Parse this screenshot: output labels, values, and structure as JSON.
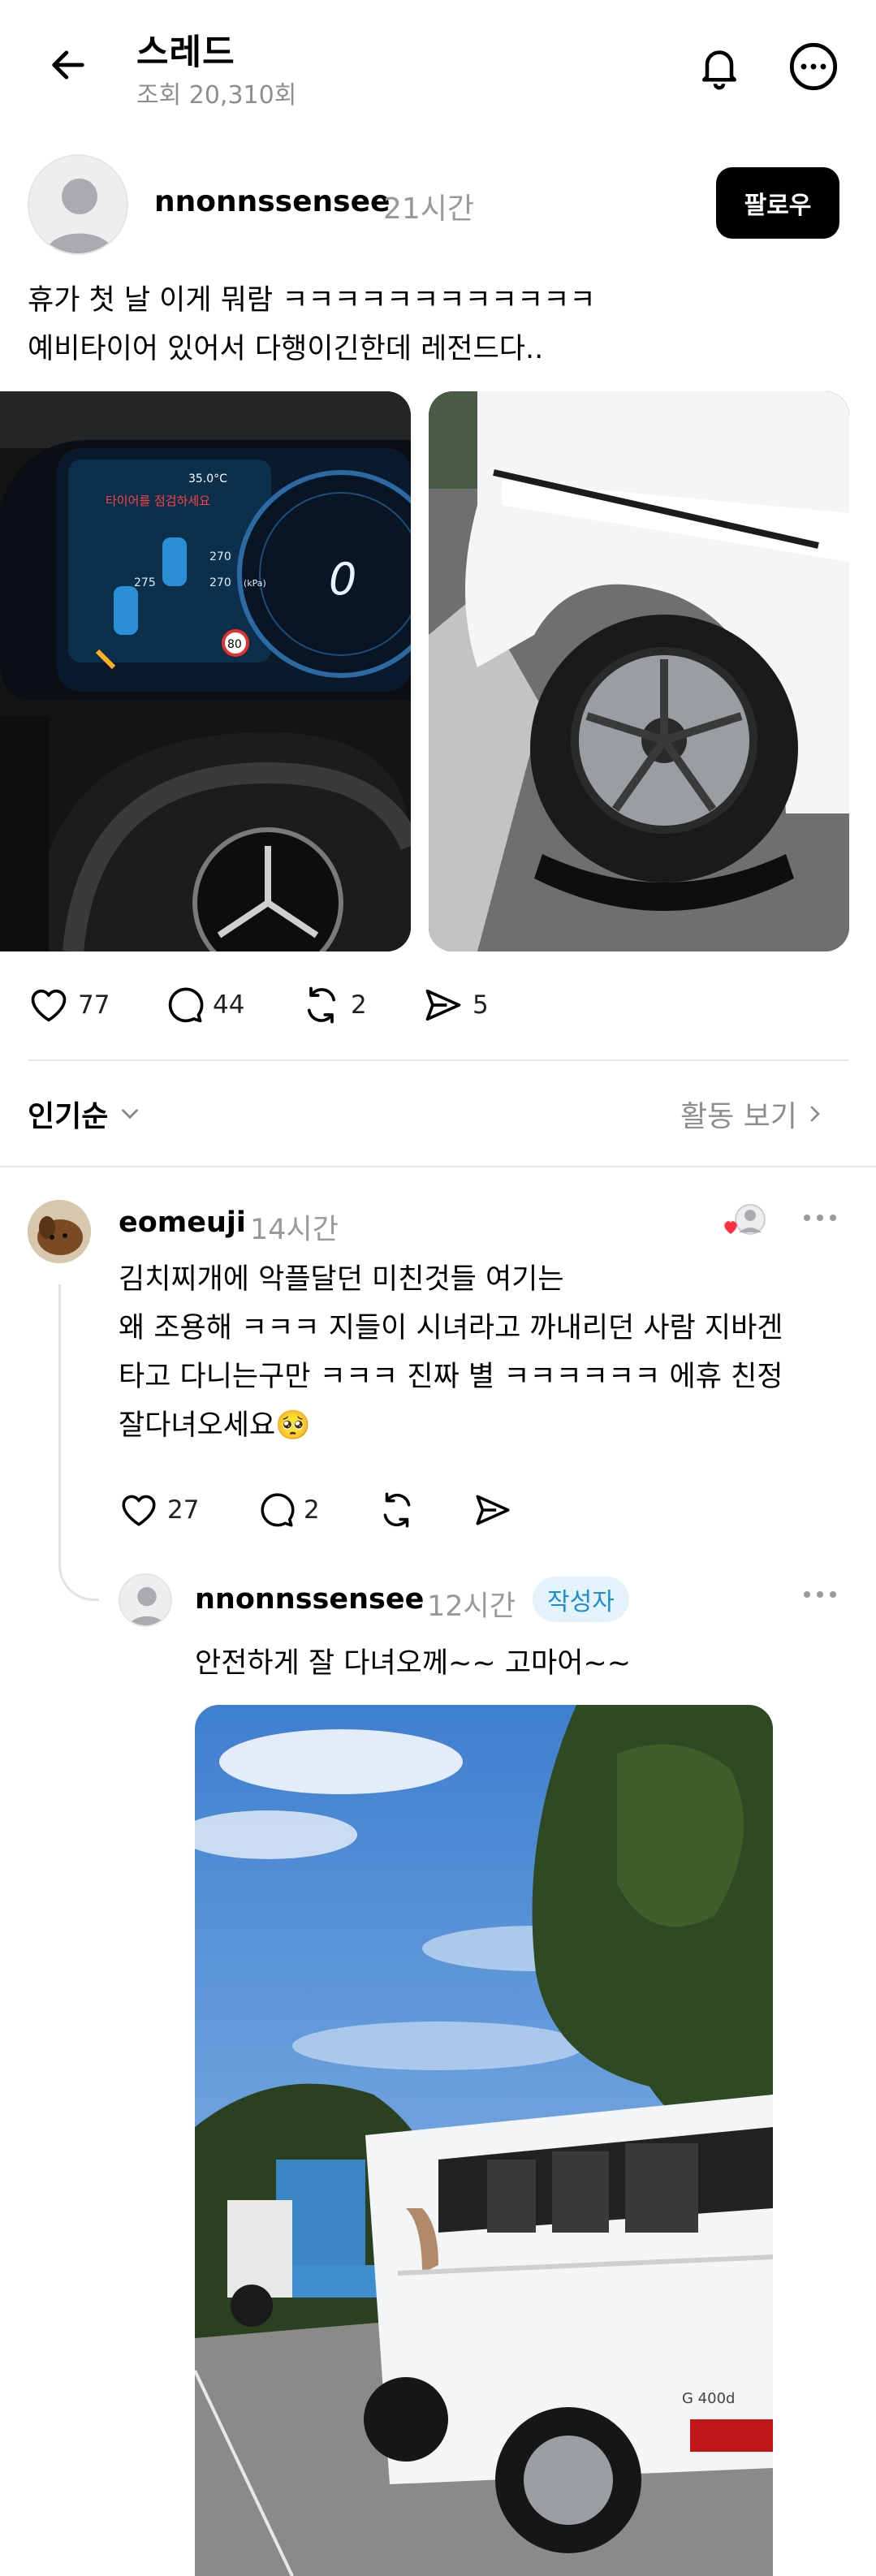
{
  "header": {
    "title": "스레드",
    "views": "조회 20,310회"
  },
  "post": {
    "username": "nnonnssensee",
    "time": "21시간",
    "follow_label": "팔로우",
    "text_lines": [
      "휴가 첫 날 이게 뭐람 ㅋㅋㅋㅋㅋㅋㅋㅋㅋㅋㅋㅋ",
      "예비타이어 있어서 다행이긴한데 레전드다.."
    ],
    "image1_alt": "tire pressure warning on dashboard",
    "image1_texts": {
      "warning": "타이어를 점검하세요",
      "temp": "35.0°C",
      "fl": "270",
      "rl": "275",
      "rr": "270",
      "unit": "(kPa)",
      "speed": "0",
      "limit": "80"
    },
    "image2_alt": "flat tire on white SUV",
    "likes": "77",
    "comments": "44",
    "reposts": "2",
    "shares": "5"
  },
  "sort": {
    "label": "인기순",
    "activity_label": "활동 보기"
  },
  "comment": {
    "username": "eomeuji",
    "time": "14시간",
    "text_lines": [
      "김치찌개에 악플달던 미친것들 여기는",
      "왜 조용해 ㅋㅋㅋ 지들이 시녀라고 까내리던 사람 지바겐",
      "타고 다니는구만 ㅋㅋㅋ 진짜 별 ㅋㅋㅋㅋㅋㅋ 에휴 친정",
      "잘다녀오세요🥺"
    ],
    "likes": "27",
    "replies": "2"
  },
  "reply": {
    "username": "nnonnssensee",
    "time": "12시간",
    "badge": "작성자",
    "text": "안전하게 잘 다녀오께~~ 고마어~~",
    "image_alt": "white SUV loaded onto tow truck",
    "plate_text": "G 400d"
  },
  "colors": {
    "accent": "#000000",
    "muted": "#8e8e8e",
    "badge_bg": "#e4f2fb",
    "badge_text": "#1a8fd6",
    "like_red": "#ff3040"
  }
}
